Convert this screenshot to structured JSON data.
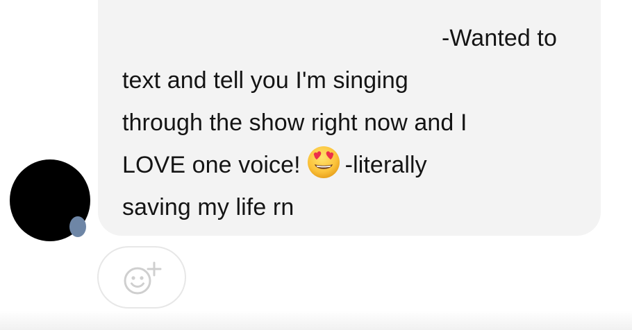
{
  "message": {
    "line1": "-Wanted to",
    "line2": "text and tell you I'm singing",
    "line3": "through the show right now and I",
    "line4_before_emoji": "LOVE one voice!",
    "line4_after_emoji": "-literally",
    "line5": "saving my life rn",
    "emoji_name": "heart-eyes-emoji"
  },
  "reaction_button": {
    "icon": "add-reaction-icon"
  },
  "colors": {
    "bubble": "#f3f3f3",
    "text": "#141414",
    "reaction_icon": "#cfcfcf"
  }
}
